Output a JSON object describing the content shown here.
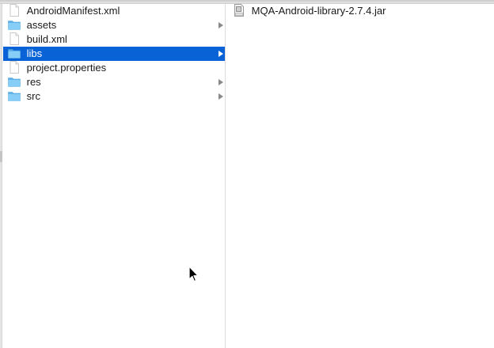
{
  "column1": {
    "items": [
      {
        "label": "AndroidManifest.xml",
        "type": "file",
        "has_children": false,
        "selected": false
      },
      {
        "label": "assets",
        "type": "folder",
        "has_children": true,
        "selected": false
      },
      {
        "label": "build.xml",
        "type": "file",
        "has_children": false,
        "selected": false
      },
      {
        "label": "libs",
        "type": "folder",
        "has_children": true,
        "selected": true
      },
      {
        "label": "project.properties",
        "type": "file",
        "has_children": false,
        "selected": false
      },
      {
        "label": "res",
        "type": "folder",
        "has_children": true,
        "selected": false
      },
      {
        "label": "src",
        "type": "folder",
        "has_children": true,
        "selected": false
      }
    ]
  },
  "column2": {
    "items": [
      {
        "label": "MQA-Android-library-2.7.4.jar",
        "type": "jar",
        "has_children": false,
        "selected": false
      }
    ]
  },
  "icons": {
    "file": "document-icon",
    "folder": "folder-icon",
    "jar": "jar-file-icon",
    "disclosure": "disclosure-arrow-icon",
    "cursor": "mouse-pointer-icon"
  },
  "colors": {
    "selection": "#0a63d6",
    "folder": "#7ec8f5",
    "divider": "#dcdcdc"
  }
}
